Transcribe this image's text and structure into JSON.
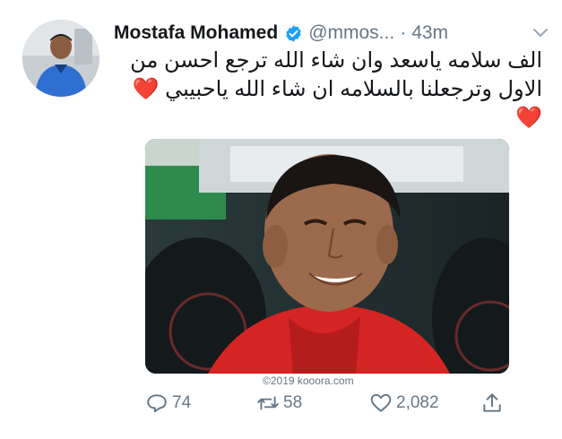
{
  "tweet": {
    "author_name": "Mostafa Mohamed",
    "handle": "@mmos...",
    "separator": "·",
    "timestamp": "43m",
    "text_line1": "الف سلامه ياسعد وان شاء الله ترجع احسن من",
    "text_line2": "الاول وترجعلنا بالسلامه ان شاء الله ياحبيبي",
    "emoji": "❤️",
    "image_watermark": "©2019 kooora.com"
  },
  "actions": {
    "replies": "74",
    "retweets": "58",
    "likes": "2,082"
  },
  "icons": {
    "verified": "verified-badge-icon",
    "menu": "chevron-down-icon",
    "reply": "reply-icon",
    "retweet": "retweet-icon",
    "like": "heart-icon",
    "share": "share-icon"
  },
  "colors": {
    "verified_blue": "#1da1f2",
    "muted_gray": "#657786",
    "heart_red": "#e0245e"
  }
}
